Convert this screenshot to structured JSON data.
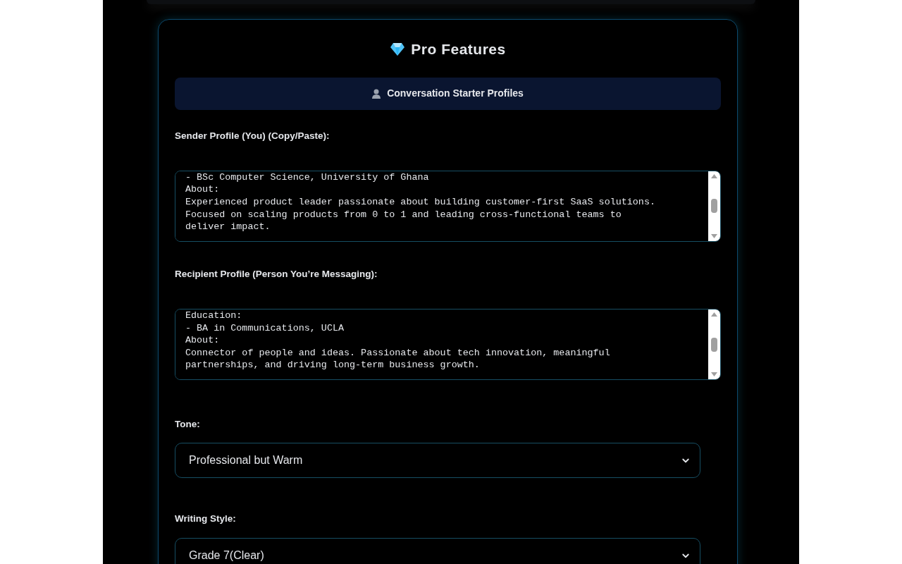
{
  "section": {
    "title": "Pro Features",
    "profiles_button": "Conversation Starter Profiles"
  },
  "fields": [
    {
      "kind": "textarea",
      "label": "Sender Profile (You) (Copy/Paste):",
      "value": "- BSc Computer Science, University of Ghana\nAbout:\nExperienced product leader passionate about building customer-first SaaS solutions.\nFocused on scaling products from 0 to 1 and leading cross-functional teams to\ndeliver impact."
    },
    {
      "kind": "textarea",
      "label": "Recipient Profile (Person You’re Messaging):",
      "value": "Education:\n- BA in Communications, UCLA\nAbout:\nConnector of people and ideas. Passionate about tech innovation, meaningful\npartnerships, and driving long-term business growth."
    },
    {
      "kind": "select",
      "label": "Tone:",
      "value": "Professional but Warm"
    },
    {
      "kind": "select",
      "label": "Writing Style:",
      "value": "Grade 7(Clear)"
    }
  ]
}
